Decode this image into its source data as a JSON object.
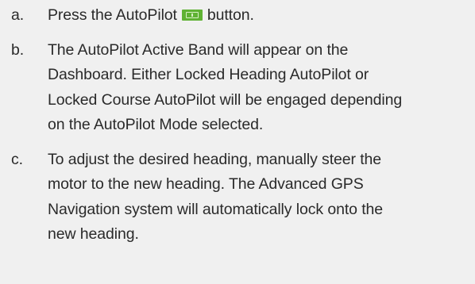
{
  "steps": [
    {
      "letter": "a.",
      "text_before_icon": "Press the AutoPilot",
      "icon": "autopilot-button-icon",
      "text_after_icon": "button."
    },
    {
      "letter": "b.",
      "lines": [
        "The AutoPilot Active Band will appear on the",
        "Dashboard. Either Locked Heading AutoPilot or",
        "Locked Course AutoPilot will be engaged depending",
        "on the AutoPilot Mode selected."
      ]
    },
    {
      "letter": "c.",
      "lines": [
        "To adjust the desired heading, manually steer the",
        "motor to the new heading. The Advanced GPS",
        "Navigation system will automatically lock onto the",
        "new heading."
      ]
    }
  ],
  "colors": {
    "background": "#f0f0f0",
    "text": "#2a2a2a",
    "icon": "#5fb233"
  }
}
